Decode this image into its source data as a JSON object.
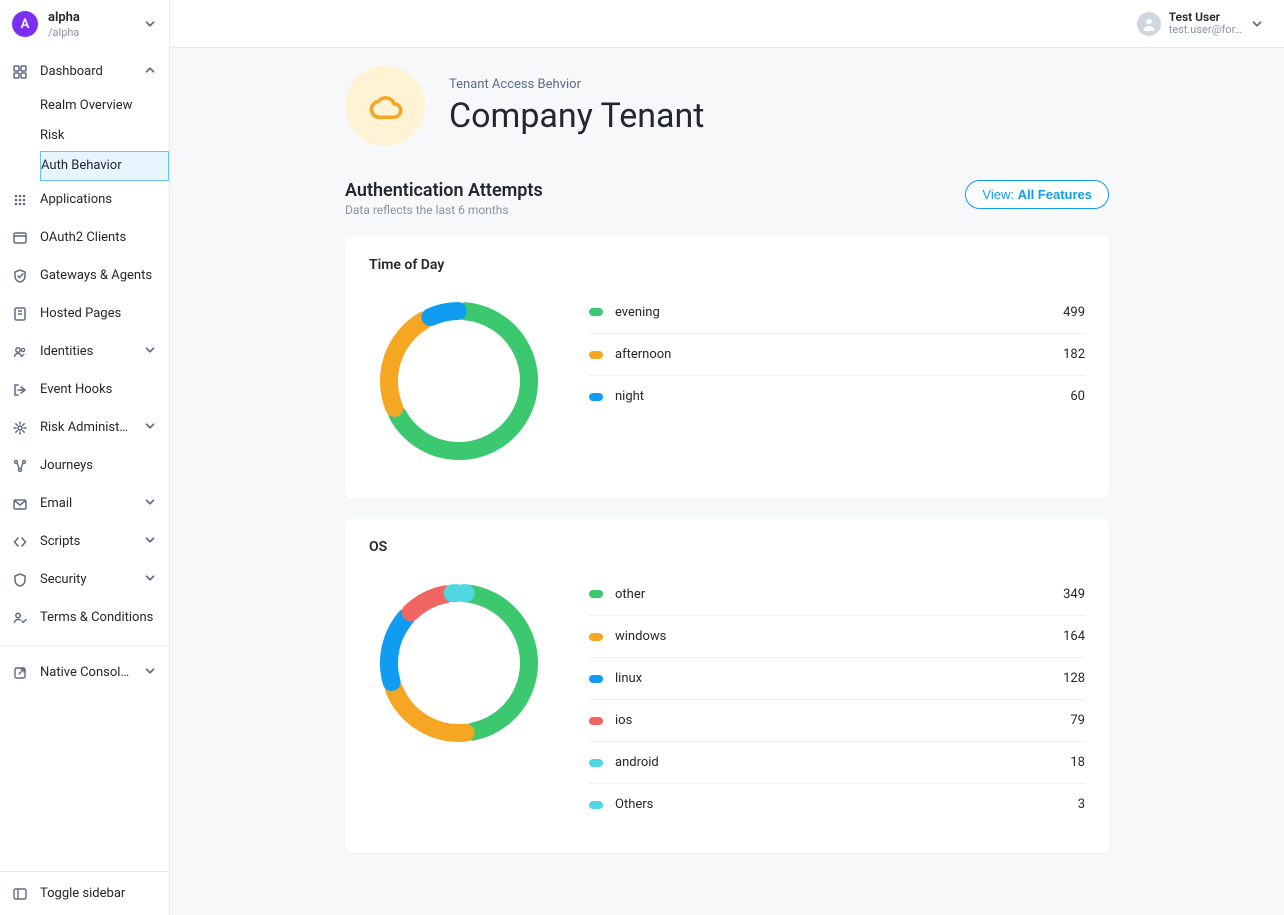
{
  "tenant": {
    "avatar_letter": "A",
    "name": "alpha",
    "path": "/alpha"
  },
  "sidebar": {
    "items": [
      {
        "label": "Dashboard",
        "icon": "dashboard",
        "expandable": true,
        "expanded": true,
        "children": [
          {
            "label": "Realm Overview"
          },
          {
            "label": "Risk"
          },
          {
            "label": "Auth Behavior",
            "active": true
          }
        ]
      },
      {
        "label": "Applications",
        "icon": "apps"
      },
      {
        "label": "OAuth2 Clients",
        "icon": "browser"
      },
      {
        "label": "Gateways & Agents",
        "icon": "shield"
      },
      {
        "label": "Hosted Pages",
        "icon": "page"
      },
      {
        "label": "Identities",
        "icon": "people",
        "expandable": true
      },
      {
        "label": "Event Hooks",
        "icon": "exit"
      },
      {
        "label": "Risk Administration",
        "icon": "gear",
        "expandable": true
      },
      {
        "label": "Journeys",
        "icon": "flow"
      },
      {
        "label": "Email",
        "icon": "mail",
        "expandable": true
      },
      {
        "label": "Scripts",
        "icon": "code",
        "expandable": true
      },
      {
        "label": "Security",
        "icon": "shield-o",
        "expandable": true
      },
      {
        "label": "Terms & Conditions",
        "icon": "person-check"
      },
      {
        "divider": true
      },
      {
        "label": "Native Consoles",
        "icon": "external",
        "expandable": true
      }
    ],
    "footer": "Toggle sidebar"
  },
  "user": {
    "name": "Test User",
    "email": "test.user@for…"
  },
  "page": {
    "eyebrow": "Tenant Access Behvior",
    "title": "Company Tenant",
    "section_title": "Authentication Attempts",
    "section_sub": "Data reflects the last 6 months",
    "view_label": "View:",
    "view_value": "All Features"
  },
  "colors": {
    "green": "#3cc86e",
    "orange": "#f5a623",
    "blue": "#109cf1",
    "coral": "#f06461",
    "teal": "#50d7e0"
  },
  "chart_data": [
    {
      "id": "tod",
      "type": "donut",
      "title": "Time of Day",
      "series": [
        {
          "name": "evening",
          "value": 499,
          "color": "green"
        },
        {
          "name": "afternoon",
          "value": 182,
          "color": "orange"
        },
        {
          "name": "night",
          "value": 60,
          "color": "blue"
        }
      ]
    },
    {
      "id": "os",
      "type": "donut",
      "title": "OS",
      "series": [
        {
          "name": "other",
          "value": 349,
          "color": "green"
        },
        {
          "name": "windows",
          "value": 164,
          "color": "orange"
        },
        {
          "name": "linux",
          "value": 128,
          "color": "blue"
        },
        {
          "name": "ios",
          "value": 79,
          "color": "coral"
        },
        {
          "name": "android",
          "value": 18,
          "color": "teal"
        },
        {
          "name": "Others",
          "value": 3,
          "color": "teal"
        }
      ]
    }
  ]
}
